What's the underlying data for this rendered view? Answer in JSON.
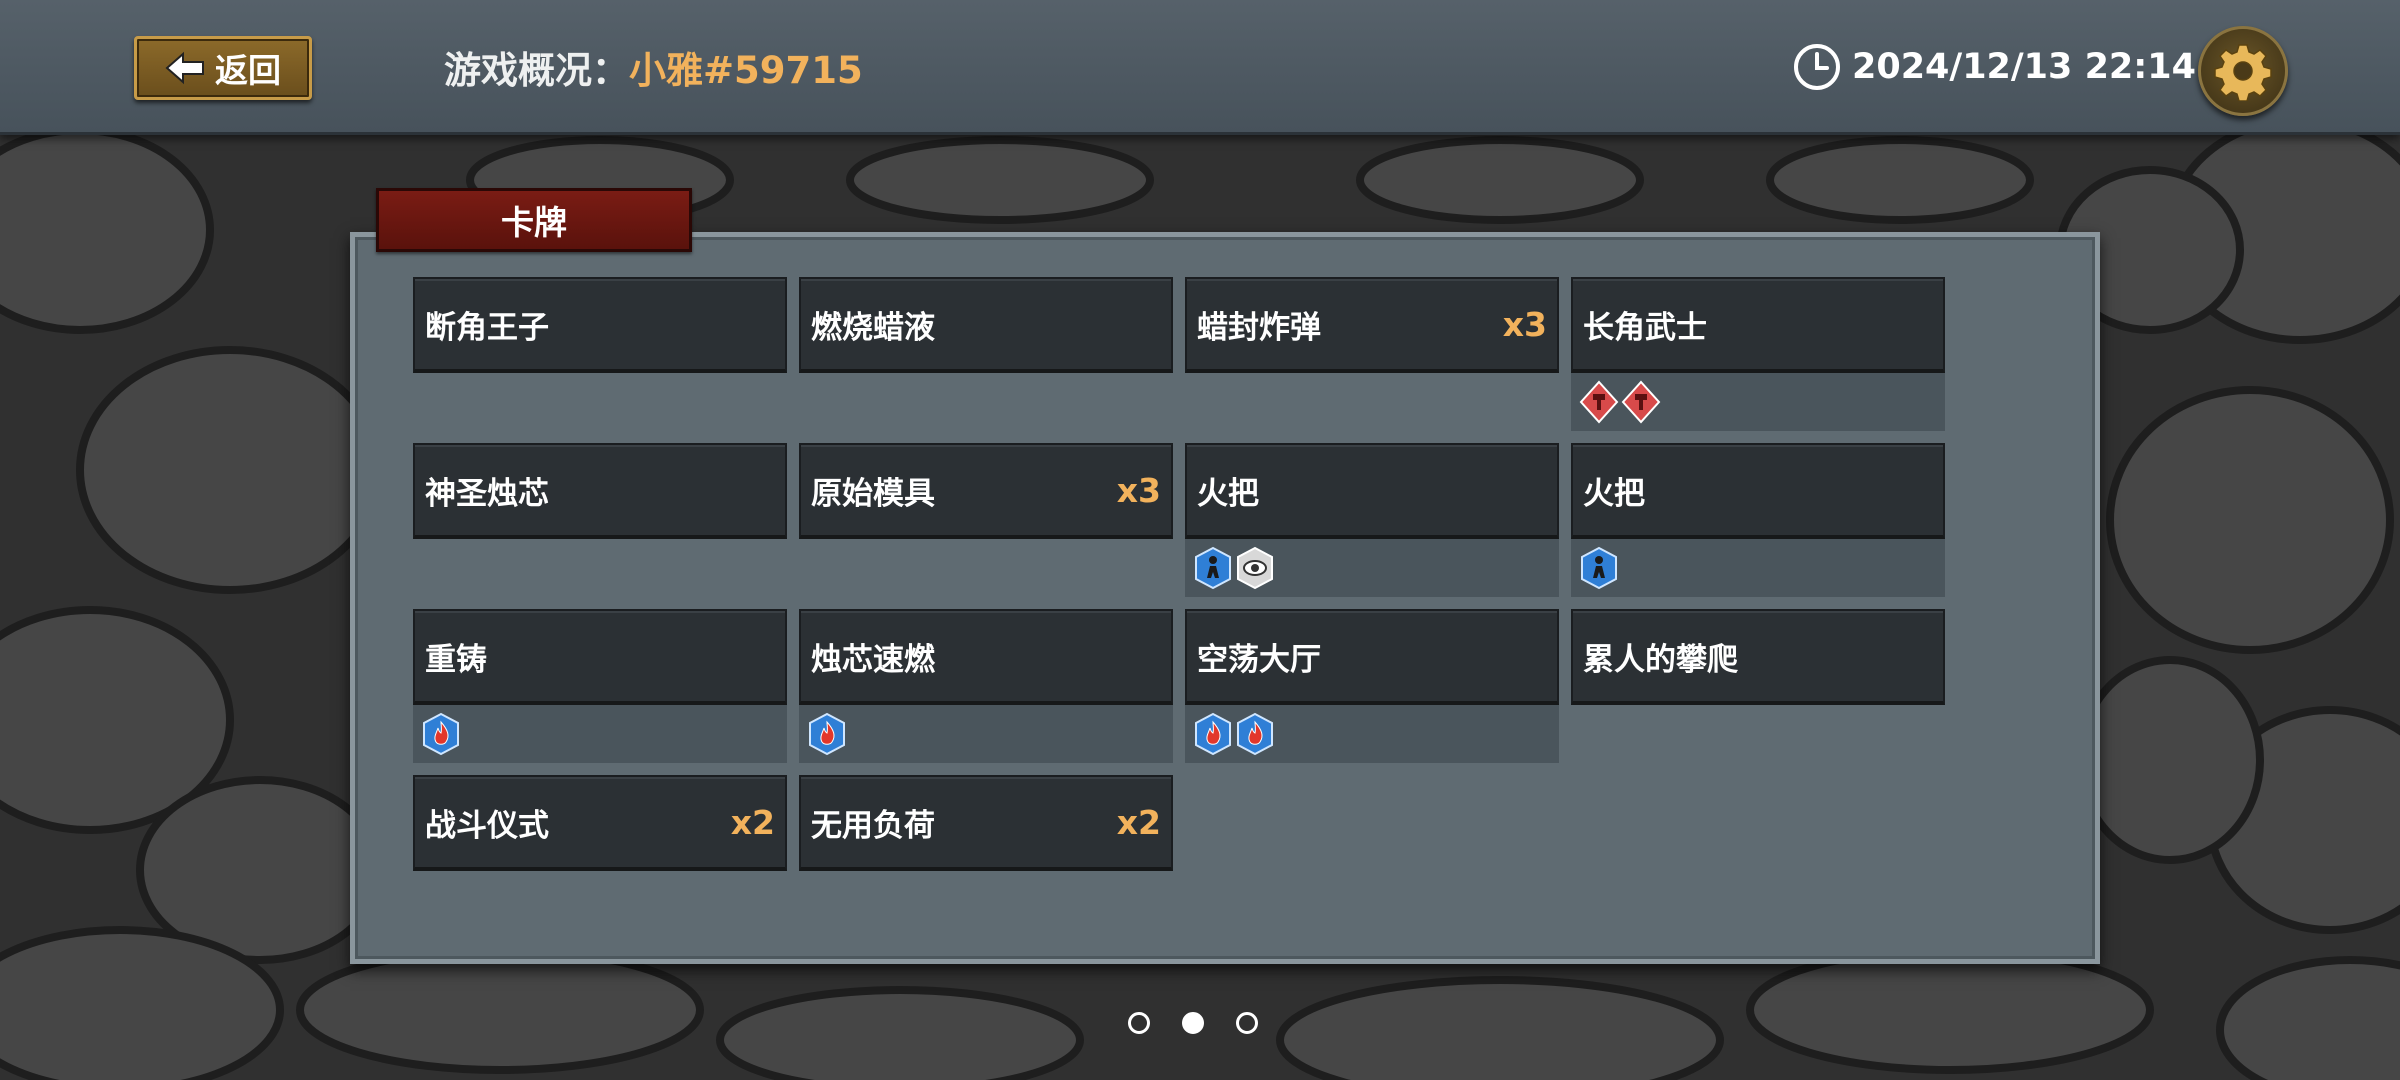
{
  "header": {
    "back_label": "返回",
    "title_prefix": "游戏概况：",
    "player_name": "小雅#59715",
    "datetime": "2024/12/13 22:14"
  },
  "panel": {
    "tab_label": "卡牌",
    "cards": [
      {
        "name": "断角王子",
        "count": "",
        "tokens": []
      },
      {
        "name": "燃烧蜡液",
        "count": "",
        "tokens": []
      },
      {
        "name": "蜡封炸弹",
        "count": "x3",
        "tokens": []
      },
      {
        "name": "长角武士",
        "count": "",
        "tokens": [
          "red-totem-icon",
          "red-totem-icon"
        ]
      },
      {
        "name": "神圣烛芯",
        "count": "",
        "tokens": []
      },
      {
        "name": "原始模具",
        "count": "x3",
        "tokens": []
      },
      {
        "name": "火把",
        "count": "",
        "tokens": [
          "blue-figure-icon",
          "white-eye-icon"
        ]
      },
      {
        "name": "火把",
        "count": "",
        "tokens": [
          "blue-figure-icon"
        ]
      },
      {
        "name": "重铸",
        "count": "",
        "tokens": [
          "blue-flame-icon"
        ]
      },
      {
        "name": "烛芯速燃",
        "count": "",
        "tokens": [
          "blue-flame-icon"
        ]
      },
      {
        "name": "空荡大厅",
        "count": "",
        "tokens": [
          "blue-flame-icon",
          "blue-flame-icon"
        ]
      },
      {
        "name": "累人的攀爬",
        "count": "",
        "tokens": []
      },
      {
        "name": "战斗仪式",
        "count": "x2",
        "tokens": []
      },
      {
        "name": "无用负荷",
        "count": "x2",
        "tokens": []
      }
    ]
  },
  "pagination": {
    "total": 3,
    "current_index": 1
  },
  "colors": {
    "accent_gold": "#f2b25c",
    "tab_red": "#7a1c14",
    "panel": "#5f6b72"
  }
}
